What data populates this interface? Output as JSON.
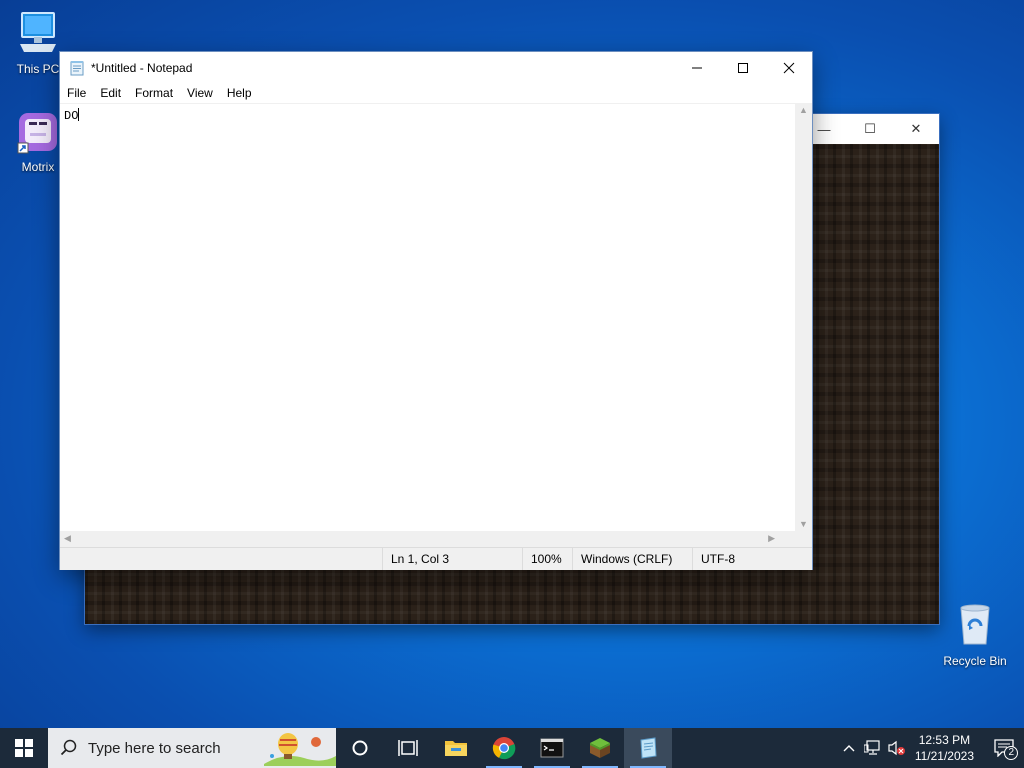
{
  "desktop": {
    "icons": [
      {
        "label": "This PC",
        "icon": "computer-icon"
      },
      {
        "label": "Motrix",
        "icon": "motrix-icon"
      },
      {
        "label": "Recycle Bin",
        "icon": "recycle-bin-icon"
      }
    ]
  },
  "notepad": {
    "title": "*Untitled - Notepad",
    "menu": [
      "File",
      "Edit",
      "Format",
      "View",
      "Help"
    ],
    "content": "DO",
    "status": {
      "position": "Ln 1, Col 3",
      "zoom": "100%",
      "line_ending": "Windows (CRLF)",
      "encoding": "UTF-8"
    }
  },
  "taskbar": {
    "search_placeholder": "Type here to search",
    "apps": [
      "cortana-icon",
      "task-view-icon",
      "file-explorer-icon",
      "chrome-icon",
      "terminal-icon",
      "minecraft-icon",
      "notepad-icon"
    ],
    "clock": {
      "time": "12:53 PM",
      "date": "11/21/2023"
    },
    "notification_count": "2"
  },
  "colors": {
    "accent": "#0b6fd3",
    "taskbar": "#1c2a3a"
  }
}
